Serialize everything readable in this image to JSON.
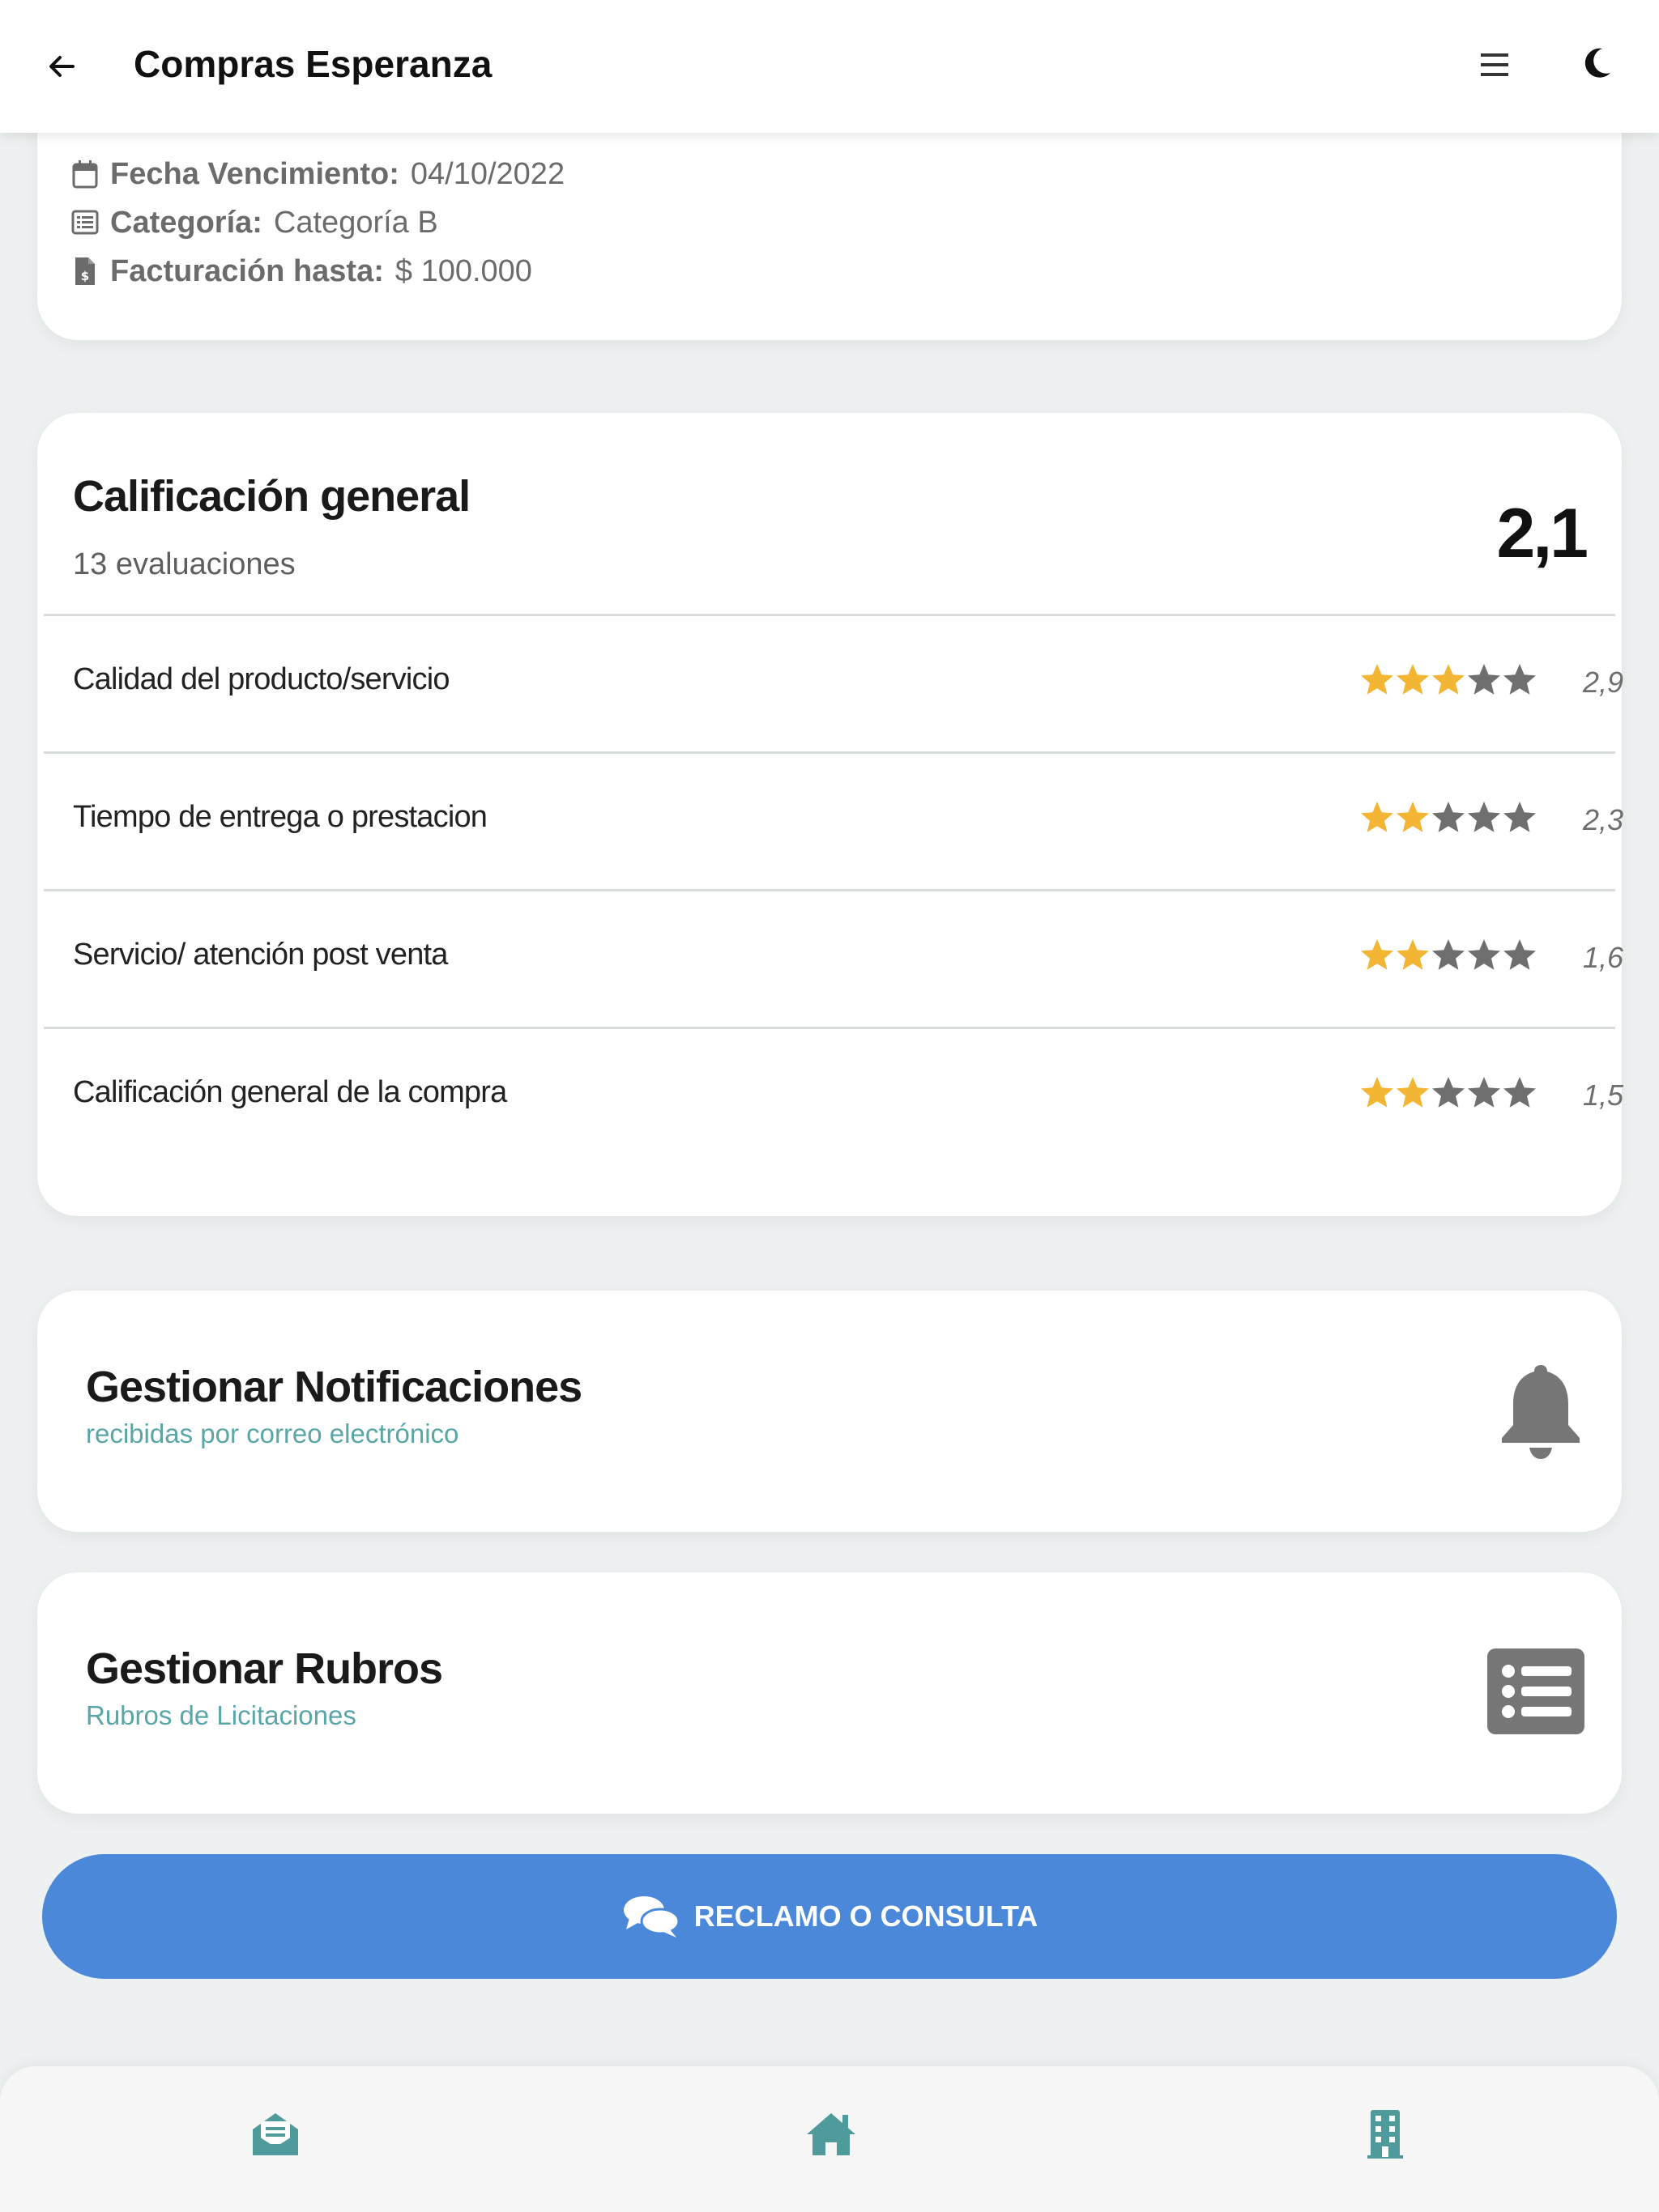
{
  "header": {
    "title": "Compras Esperanza",
    "back_icon": "arrow-left-icon",
    "menu_icon": "hamburger-icon",
    "theme_icon": "moon-icon"
  },
  "info": {
    "due_date_label": "Fecha Vencimiento:",
    "due_date_value": "04/10/2022",
    "category_label": "Categoría:",
    "category_value": "Categoría B",
    "billing_label": "Facturación hasta:",
    "billing_value": "$ 100.000"
  },
  "rating": {
    "title": "Calificación general",
    "count": "13 evaluaciones",
    "score": "2,1",
    "star_color": "#f3b534",
    "star_empty_color": "#6f6f6f",
    "criteria": [
      {
        "label": "Calidad del producto/servicio",
        "value": "2,9",
        "stars_filled": 3
      },
      {
        "label": "Tiempo de entrega o prestacion",
        "value": "2,3",
        "stars_filled": 2
      },
      {
        "label": "Servicio/ atención post venta",
        "value": "1,6",
        "stars_filled": 2
      },
      {
        "label": "Calificación general de la compra",
        "value": "1,5",
        "stars_filled": 2
      }
    ]
  },
  "notifications": {
    "title": "Gestionar Notificaciones",
    "subtitle": "recibidas por correo electrónico",
    "icon": "bell-icon"
  },
  "rubros": {
    "title": "Gestionar Rubros",
    "subtitle": "Rubros de Licitaciones",
    "icon": "list-icon"
  },
  "cta": {
    "label": "RECLAMO O CONSULTA",
    "icon": "chat-bubbles-icon",
    "color": "#4b88d9"
  },
  "tabbar": {
    "tabs": [
      "mail-open-icon",
      "home-icon",
      "building-icon"
    ],
    "icon_color": "#4f9a9a"
  }
}
